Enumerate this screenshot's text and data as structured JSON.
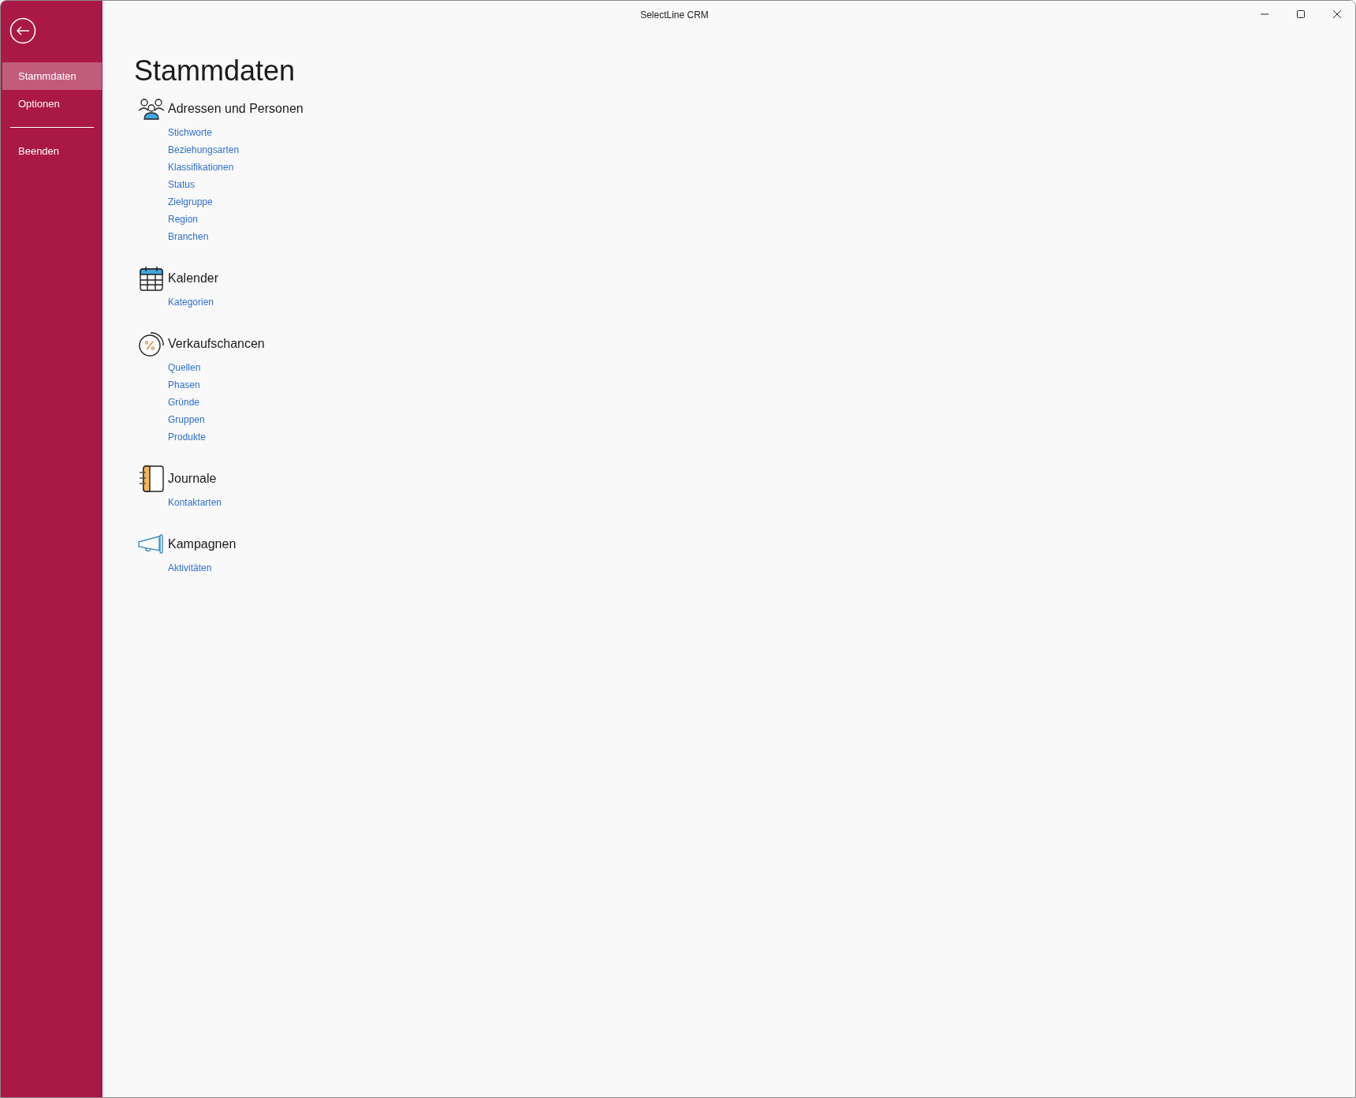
{
  "window": {
    "title": "SelectLine CRM"
  },
  "sidebar": {
    "items": [
      {
        "label": "Stammdaten",
        "selected": true
      },
      {
        "label": "Optionen",
        "selected": false
      }
    ],
    "footer_items": [
      {
        "label": "Beenden",
        "selected": false
      }
    ]
  },
  "page": {
    "title": "Stammdaten",
    "sections": [
      {
        "kind": "people",
        "title": "Adressen und Personen",
        "links": [
          "Stichworte",
          "Beziehungsarten",
          "Klassifikationen",
          "Status",
          "Zielgruppe",
          "Region",
          "Branchen"
        ]
      },
      {
        "kind": "calendar",
        "title": "Kalender",
        "links": [
          "Kategorien"
        ]
      },
      {
        "kind": "percent",
        "title": "Verkaufschancen",
        "links": [
          "Quellen",
          "Phasen",
          "Gründe",
          "Gruppen",
          "Produkte"
        ]
      },
      {
        "kind": "notebook",
        "title": "Journale",
        "links": [
          "Kontaktarten"
        ]
      },
      {
        "kind": "megaphone",
        "title": "Kampagnen",
        "links": [
          "Aktivitäten"
        ]
      }
    ]
  }
}
